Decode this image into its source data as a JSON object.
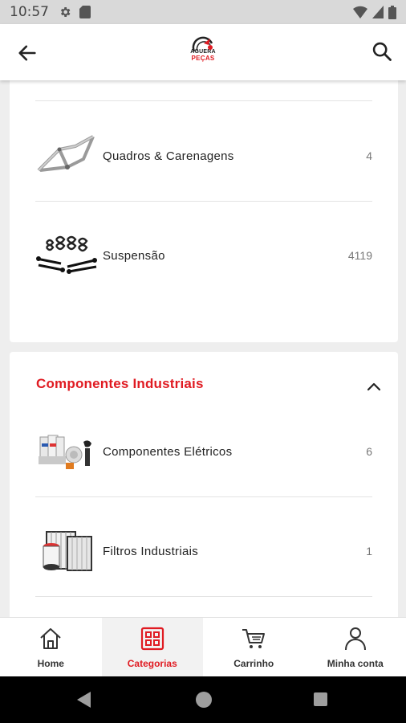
{
  "status_bar": {
    "time": "10:57"
  },
  "app_bar": {
    "logo_line1": "AGUERA",
    "logo_line2": "PEÇAS"
  },
  "categories": {
    "group1_items": [
      {
        "label": "Quadros & Carenagens",
        "count": "4",
        "icon": "frame-fairing-icon"
      },
      {
        "label": "Suspensão",
        "count": "4119",
        "icon": "suspension-icon"
      }
    ],
    "group2": {
      "title": "Componentes Industriais",
      "items": [
        {
          "label": "Componentes Elétricos",
          "count": "6",
          "icon": "electrical-components-icon"
        },
        {
          "label": "Filtros Industriais",
          "count": "1",
          "icon": "industrial-filters-icon"
        }
      ]
    }
  },
  "bottom_nav": [
    {
      "label": "Home",
      "icon": "home-icon",
      "active": false
    },
    {
      "label": "Categorias",
      "icon": "categories-icon",
      "active": true
    },
    {
      "label": "Carrinho",
      "icon": "cart-icon",
      "active": false
    },
    {
      "label": "Minha conta",
      "icon": "account-icon",
      "active": false
    }
  ],
  "colors": {
    "brand_red": "#e01b22",
    "text": "#222222",
    "count": "#777777"
  }
}
